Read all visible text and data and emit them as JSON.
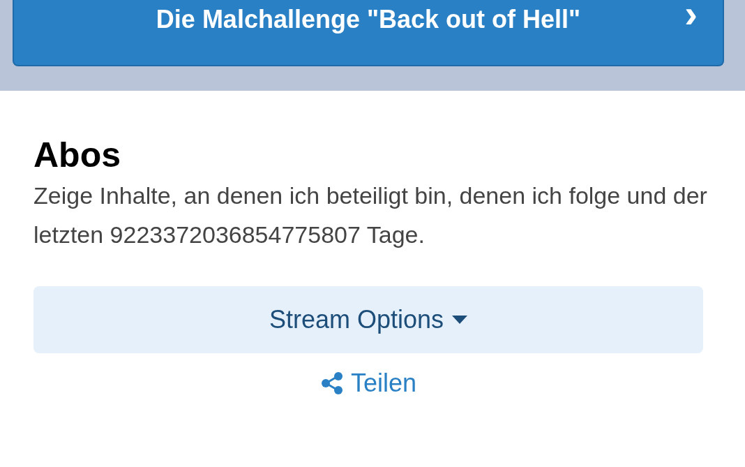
{
  "banner_button": {
    "label": "Die Malchallenge \"Back out of Hell\"",
    "chevron": "›"
  },
  "section": {
    "title": "Abos",
    "description": "Zeige Inhalte, an denen ich beteiligt bin, denen ich folge und der letzten 9223372036854775807 Tage."
  },
  "stream_options": {
    "label": "Stream Options"
  },
  "share_link": {
    "label": "Teilen"
  }
}
